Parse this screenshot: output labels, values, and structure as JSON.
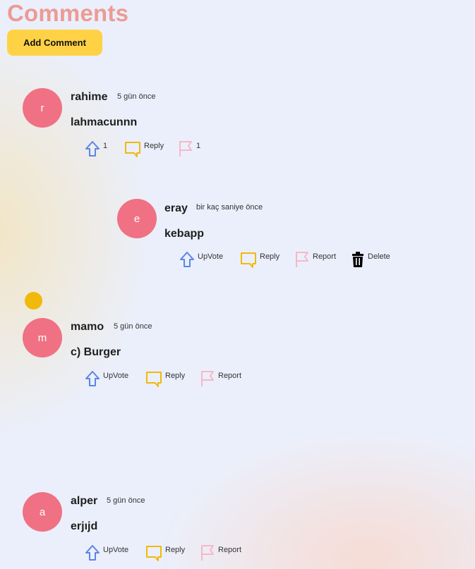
{
  "header": {
    "title": "Comments",
    "add_button": "Add Comment"
  },
  "colors": {
    "avatar": "#f07184",
    "title": "#ec9b95",
    "button": "#ffd246",
    "upvote": "#5a86e6",
    "reply": "#f0b90b",
    "report": "#f5b8c8",
    "dot": "#f0b90b"
  },
  "comments": [
    {
      "initial": "r",
      "name": "rahime",
      "time": "5 gün önce",
      "text": "lahmacunnn",
      "actions": {
        "upvote": "1",
        "reply": "Reply",
        "report": "1"
      }
    },
    {
      "initial": "e",
      "name": "eray",
      "time": "bir kaç saniye önce",
      "text": "kebapp",
      "actions": {
        "upvote": "UpVote",
        "reply": "Reply",
        "report": "Report",
        "delete": "Delete"
      }
    },
    {
      "initial": "m",
      "name": "mamo",
      "time": "5 gün önce",
      "text": "c) Burger",
      "actions": {
        "upvote": "UpVote",
        "reply": "Reply",
        "report": "Report"
      }
    },
    {
      "initial": "a",
      "name": "alper",
      "time": "5 gün önce",
      "text": "erjıjd",
      "actions": {
        "upvote": "UpVote",
        "reply": "Reply",
        "report": "Report"
      }
    }
  ]
}
